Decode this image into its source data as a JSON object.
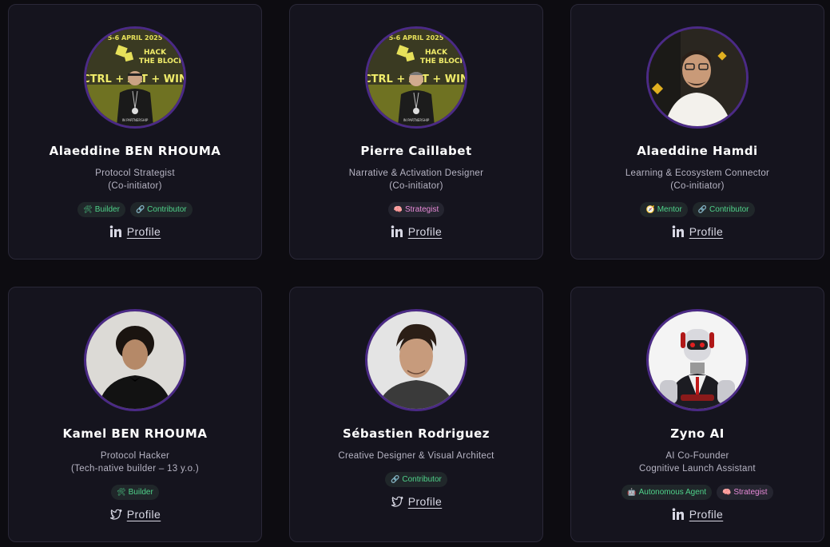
{
  "cards": [
    {
      "name": "Alaeddine BEN RHOUMA",
      "role": [
        "Protocol Strategist",
        "(Co-initiator)"
      ],
      "tags": [
        {
          "icon": "🛠",
          "label": "Builder"
        },
        {
          "icon": "🔗",
          "label": "Contributor"
        }
      ],
      "profile": {
        "icon": "linkedin-icon",
        "label": "Profile"
      }
    },
    {
      "name": "Pierre Caillabet",
      "role": [
        "Narrative & Activation Designer",
        "(Co-initiator)"
      ],
      "tags": [
        {
          "icon": "🧠",
          "label": "Strategist"
        }
      ],
      "profile": {
        "icon": "linkedin-icon",
        "label": "Profile"
      }
    },
    {
      "name": "Alaeddine Hamdi",
      "role": [
        "Learning & Ecosystem Connector",
        "(Co-initiator)"
      ],
      "tags": [
        {
          "icon": "🧭",
          "label": "Mentor"
        },
        {
          "icon": "🔗",
          "label": "Contributor"
        }
      ],
      "profile": {
        "icon": "linkedin-icon",
        "label": "Profile"
      }
    },
    {
      "name": "Kamel BEN RHOUMA",
      "role": [
        "Protocol Hacker",
        "(Tech-native builder – 13 y.o.)"
      ],
      "tags": [
        {
          "icon": "🛠",
          "label": "Builder"
        }
      ],
      "profile": {
        "icon": "twitter-icon",
        "label": "Profile"
      }
    },
    {
      "name": "Sébastien Rodriguez",
      "role": [
        "Creative Designer & Visual Architect"
      ],
      "tags": [
        {
          "icon": "🔗",
          "label": "Contributor"
        }
      ],
      "profile": {
        "icon": "twitter-icon",
        "label": "Profile"
      }
    },
    {
      "name": "Zyno AI",
      "role": [
        "AI Co-Founder",
        "Cognitive Launch Assistant"
      ],
      "tags": [
        {
          "icon": "🤖",
          "label": "Autonomous Agent"
        },
        {
          "icon": "🧠",
          "label": "Strategist"
        }
      ],
      "profile": {
        "icon": "linkedin-icon",
        "label": "Profile"
      }
    }
  ],
  "banner": {
    "date": "5-6 APRIL 2025",
    "line1": "HACK",
    "line2": "THE BLOCK",
    "line3": "CTRL + ALT + WIN",
    "footer": "IN PARTNERSHIP"
  },
  "colors": {
    "background": "#0d0c11",
    "card": "#15141e",
    "avatar_ring": "#4b2a86",
    "tag_text": "#4fd28a"
  }
}
